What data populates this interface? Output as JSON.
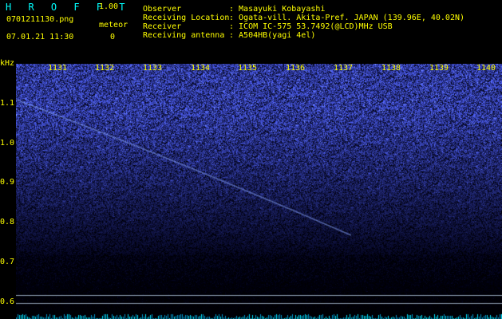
{
  "header": {
    "app_title": "H R O F F T",
    "version": "1.00",
    "file_name": "0701211130.png",
    "meteor_label": "meteor",
    "date_time": "07.01.21 11:30",
    "meteor_count": "0"
  },
  "info": [
    {
      "label": "Observer",
      "value": ": Masayuki Kobayashi"
    },
    {
      "label": "Receiving Location",
      "value": ": Ogata-vill. Akita-Pref. JAPAN (139.96E, 40.02N)"
    },
    {
      "label": "Receiver",
      "value": ": ICOM IC-575 53.7492(@LCD)MHz USB"
    },
    {
      "label": "Receiving antenna",
      "value": ": A504HB(yagi 4el)"
    }
  ],
  "axis": {
    "freq_unit": "kHz",
    "time_ticks": [
      "1131",
      "1132",
      "1133",
      "1134",
      "1135",
      "1136",
      "1137",
      "1138",
      "1139",
      "1140"
    ],
    "freq_ticks": [
      "1.1",
      "1.0",
      "0.9",
      "0.8",
      "0.7",
      "0.6"
    ]
  },
  "colors": {
    "header_text": "#ffff00",
    "title_text": "#00ffff",
    "background": "#000000",
    "spectrogram_low": "#000033",
    "spectrogram_high": "#6677ff"
  }
}
